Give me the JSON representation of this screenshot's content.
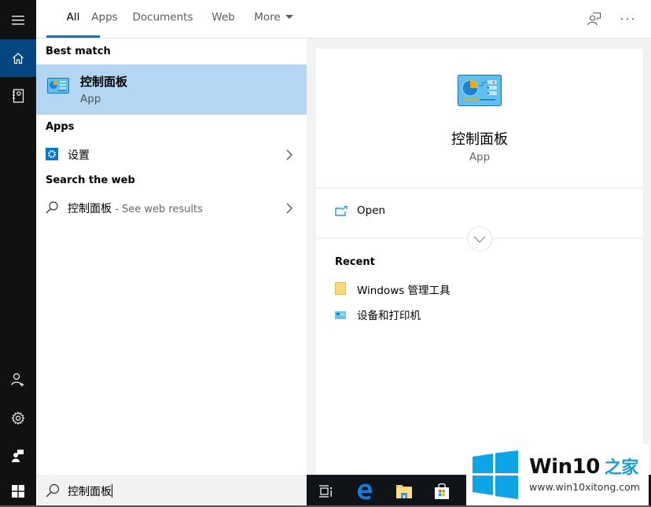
{
  "tabs": [
    {
      "label": "All",
      "active": true
    },
    {
      "label": "Apps"
    },
    {
      "label": "Documents"
    },
    {
      "label": "Web"
    },
    {
      "label": "More"
    }
  ],
  "top_icons": {
    "feedback": "feedback-icon",
    "more": "more-options-icon"
  },
  "rail": {
    "items": [
      "hamburger-menu",
      "home",
      "notebook",
      "add-user",
      "settings",
      "feedback"
    ]
  },
  "results": {
    "best_match_header": "Best match",
    "best_match": {
      "title": "控制面板",
      "subtitle": "App"
    },
    "apps_header": "Apps",
    "apps": [
      {
        "label": "设置"
      }
    ],
    "web_header": "Search the web",
    "web": {
      "query": "控制面板",
      "suffix": " - See web results"
    }
  },
  "preview": {
    "name": "控制面板",
    "type": "App",
    "actions": [
      {
        "label": "Open"
      }
    ],
    "recent_header": "Recent",
    "recent": [
      {
        "label": "Windows 管理工具",
        "icon": "folder"
      },
      {
        "label": "设备和打印机",
        "icon": "devices"
      }
    ]
  },
  "search": {
    "value": "控制面板"
  },
  "taskbar": {
    "items": [
      "task-view",
      "edge",
      "file-explorer",
      "store"
    ]
  },
  "watermark": {
    "brand": "Win10",
    "brand_cn": "之家",
    "url": "www.win10xitong.com"
  },
  "colors": {
    "accent": "#0078d7",
    "selected_bg": "#b3d7f2",
    "rail_bg": "#111111",
    "rail_active": "#04467f"
  }
}
